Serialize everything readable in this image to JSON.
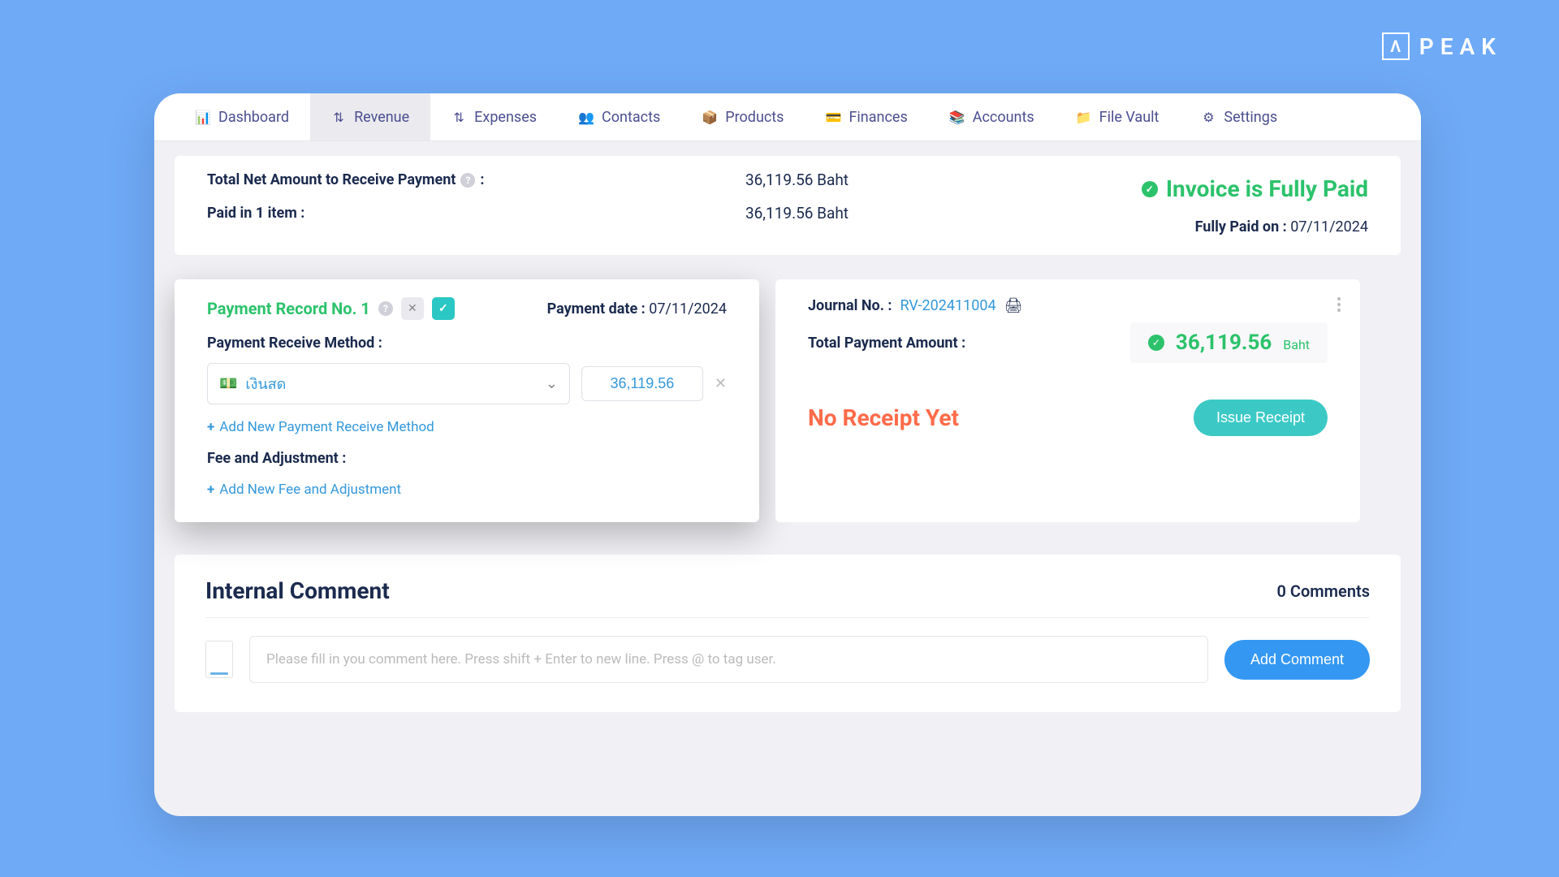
{
  "brand": "PEAK",
  "nav": {
    "items": [
      {
        "label": "Dashboard",
        "icon": "📊"
      },
      {
        "label": "Revenue",
        "icon": "⇅",
        "active": true
      },
      {
        "label": "Expenses",
        "icon": "⇅"
      },
      {
        "label": "Contacts",
        "icon": "👥"
      },
      {
        "label": "Products",
        "icon": "📦"
      },
      {
        "label": "Finances",
        "icon": "💳"
      },
      {
        "label": "Accounts",
        "icon": "📚"
      },
      {
        "label": "File Vault",
        "icon": "📁"
      },
      {
        "label": "Settings",
        "icon": "⚙"
      }
    ]
  },
  "summary": {
    "net_label": "Total Net Amount to Receive Payment",
    "net_value": "36,119.56 Baht",
    "paid_label": "Paid in 1 item :",
    "paid_value": "36,119.56 Baht",
    "status": "Invoice is Fully Paid",
    "paid_on_label": "Fully Paid on :",
    "paid_on_date": "07/11/2024"
  },
  "payment_record": {
    "title": "Payment Record No. 1",
    "date_label": "Payment date :",
    "date_value": "07/11/2024",
    "method_label": "Payment Receive Method :",
    "method_selected": "เงินสด",
    "method_amount": "36,119.56",
    "add_method_label": "Add New Payment Receive Method",
    "fee_label": "Fee and Adjustment :",
    "add_fee_label": "Add New Fee and Adjustment"
  },
  "journal": {
    "label": "Journal No. :",
    "number": "RV-202411004",
    "total_label": "Total Payment Amount :",
    "total_amount": "36,119.56",
    "total_unit": "Baht",
    "no_receipt": "No Receipt Yet",
    "issue_btn": "Issue Receipt"
  },
  "comments": {
    "title": "Internal Comment",
    "count_label": "0 Comments",
    "placeholder": "Please fill in you comment here. Press shift + Enter to new line. Press @ to tag user.",
    "add_btn": "Add Comment"
  }
}
